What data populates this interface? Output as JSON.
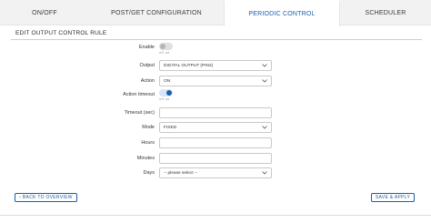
{
  "tabs": [
    {
      "label": "ON/OFF"
    },
    {
      "label": "POST/GET CONFIGURATION"
    },
    {
      "label": "PERIODIC CONTROL"
    },
    {
      "label": "SCHEDULER"
    }
  ],
  "section": {
    "title": "EDIT OUTPUT CONTROL RULE"
  },
  "form": {
    "enable": {
      "label": "Enable",
      "state": "off",
      "caption": "off  on"
    },
    "output": {
      "label": "Output",
      "value": "DIGITAL OUTPUT (PIN2)"
    },
    "action": {
      "label": "Action",
      "value": "ON"
    },
    "action_timeout": {
      "label": "Action timeout",
      "state": "on",
      "caption": "off  on"
    },
    "timeout": {
      "label": "Timeout (sec)",
      "value": ""
    },
    "mode": {
      "label": "Mode",
      "value": "FIXED"
    },
    "hours": {
      "label": "Hours",
      "value": ""
    },
    "minutes": {
      "label": "Minutes",
      "value": ""
    },
    "days": {
      "label": "Days",
      "value": "-- please select --"
    }
  },
  "buttons": {
    "back": "‹  BACK TO OVERVIEW",
    "save": "SAVE & APPLY"
  },
  "colors": {
    "accent": "#1a5faa",
    "tab_bar": "#f2f2f2",
    "border": "#c9c9c9"
  },
  "icons": [
    "chevron-down-icon"
  ]
}
